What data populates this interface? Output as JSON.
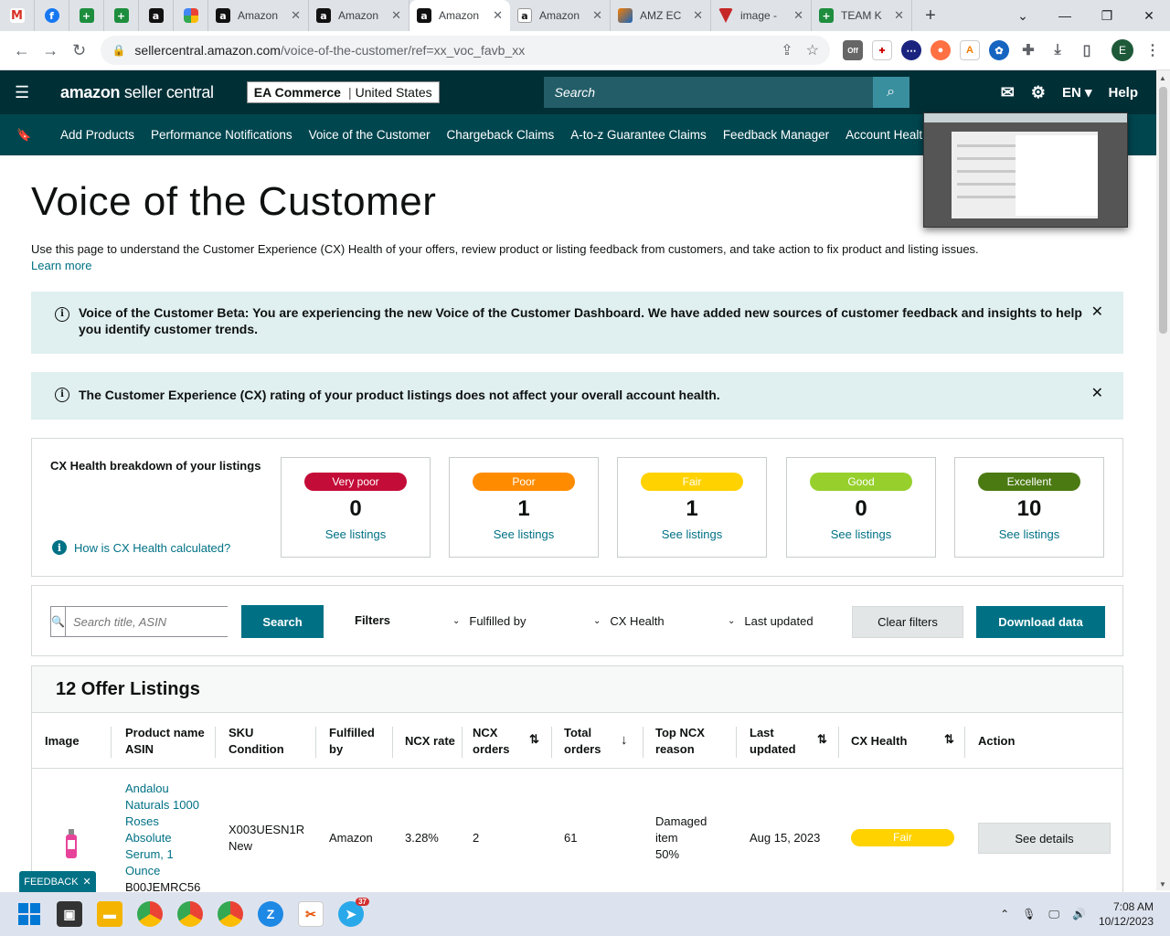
{
  "browser": {
    "tabs": [
      {
        "title": "Amazon",
        "icon": "amazon-icon"
      },
      {
        "title": "Amazon",
        "icon": "amazon-icon"
      },
      {
        "title": "Amazon",
        "icon": "amazon-icon",
        "active": true
      },
      {
        "title": "Amazon",
        "icon": "amazon-smile-icon"
      },
      {
        "title": "AMZ EC",
        "icon": "amz-ec-icon"
      },
      {
        "title": "image -",
        "icon": "image-icon"
      },
      {
        "title": "TEAM K",
        "icon": "sheets-icon"
      }
    ],
    "url_host": "sellercentral.amazon.com",
    "url_path": "/voice-of-the-customer/ref=xx_voc_favb_xx",
    "ext_off_label": "Off",
    "profile_initial": "E"
  },
  "header": {
    "logo_bold": "amazon",
    "logo_light": " seller central",
    "store_name": "EA Commerce",
    "store_region": "United States",
    "search_placeholder": "Search",
    "lang": "EN",
    "help": "Help"
  },
  "nav": {
    "links": [
      "Add Products",
      "Performance Notifications",
      "Voice of the Customer",
      "Chargeback Claims",
      "A-to-z Guarantee Claims",
      "Feedback Manager",
      "Account Health"
    ]
  },
  "page": {
    "title": "Voice of the Customer",
    "intro": "Use this page to understand the Customer Experience (CX) Health of your offers, review product or listing feedback from customers, and take action to fix product and listing issues.",
    "learn_more": "Learn more",
    "banner1": "Voice of the Customer Beta: You are experiencing the new Voice of the Customer Dashboard. We have added new sources of customer feedback and insights to help you identify customer trends.",
    "banner2": "The Customer Experience (CX) rating of your product listings does not affect your overall account health."
  },
  "cx": {
    "title": "CX Health breakdown of your listings",
    "howto": "How is CX Health calculated?",
    "tiles": [
      {
        "label": "Very poor",
        "count": "0",
        "link": "See listings",
        "color": "#c40c38"
      },
      {
        "label": "Poor",
        "count": "1",
        "link": "See listings",
        "color": "#ff8c00"
      },
      {
        "label": "Fair",
        "count": "1",
        "link": "See listings",
        "color": "#ffd200"
      },
      {
        "label": "Good",
        "count": "0",
        "link": "See listings",
        "color": "#97d02c"
      },
      {
        "label": "Excellent",
        "count": "10",
        "link": "See listings",
        "color": "#4b7a12"
      }
    ]
  },
  "filters": {
    "search_placeholder": "Search title, ASIN",
    "search_btn": "Search",
    "label": "Filters",
    "fulfilled_by": "Fulfilled by",
    "cx_health": "CX Health",
    "last_updated": "Last updated",
    "clear": "Clear filters",
    "download": "Download data"
  },
  "listings": {
    "heading": "12 Offer Listings",
    "columns": {
      "image": "Image",
      "product_1": "Product name",
      "product_2": "ASIN",
      "sku_1": "SKU",
      "sku_2": "Condition",
      "fulfilled_1": "Fulfilled",
      "fulfilled_2": "by",
      "ncx_rate": "NCX rate",
      "ncx_orders_1": "NCX",
      "ncx_orders_2": "orders",
      "total_1": "Total",
      "total_2": "orders",
      "top_1": "Top NCX",
      "top_2": "reason",
      "last_1": "Last",
      "last_2": "updated",
      "cx_health": "CX Health",
      "action": "Action"
    },
    "rows": [
      {
        "product_lines": [
          "Andalou",
          "Naturals 1000",
          "Roses",
          "Absolute",
          "Serum, 1",
          "Ounce"
        ],
        "asin": "B00JEMRC56",
        "sku": "X003UESN1R",
        "condition": "New",
        "fulfilled_by": "Amazon",
        "ncx_rate": "3.28%",
        "ncx_orders": "2",
        "total_orders": "61",
        "reason_1": "Damaged",
        "reason_2": "item",
        "reason_pct": "50%",
        "last_updated": "Aug 15, 2023",
        "cx_health": "Fair",
        "action": "See details"
      }
    ]
  },
  "feedback": "FEEDBACK",
  "taskbar": {
    "telegram_badge": "37",
    "time": "7:08 AM",
    "date": "10/12/2023"
  }
}
